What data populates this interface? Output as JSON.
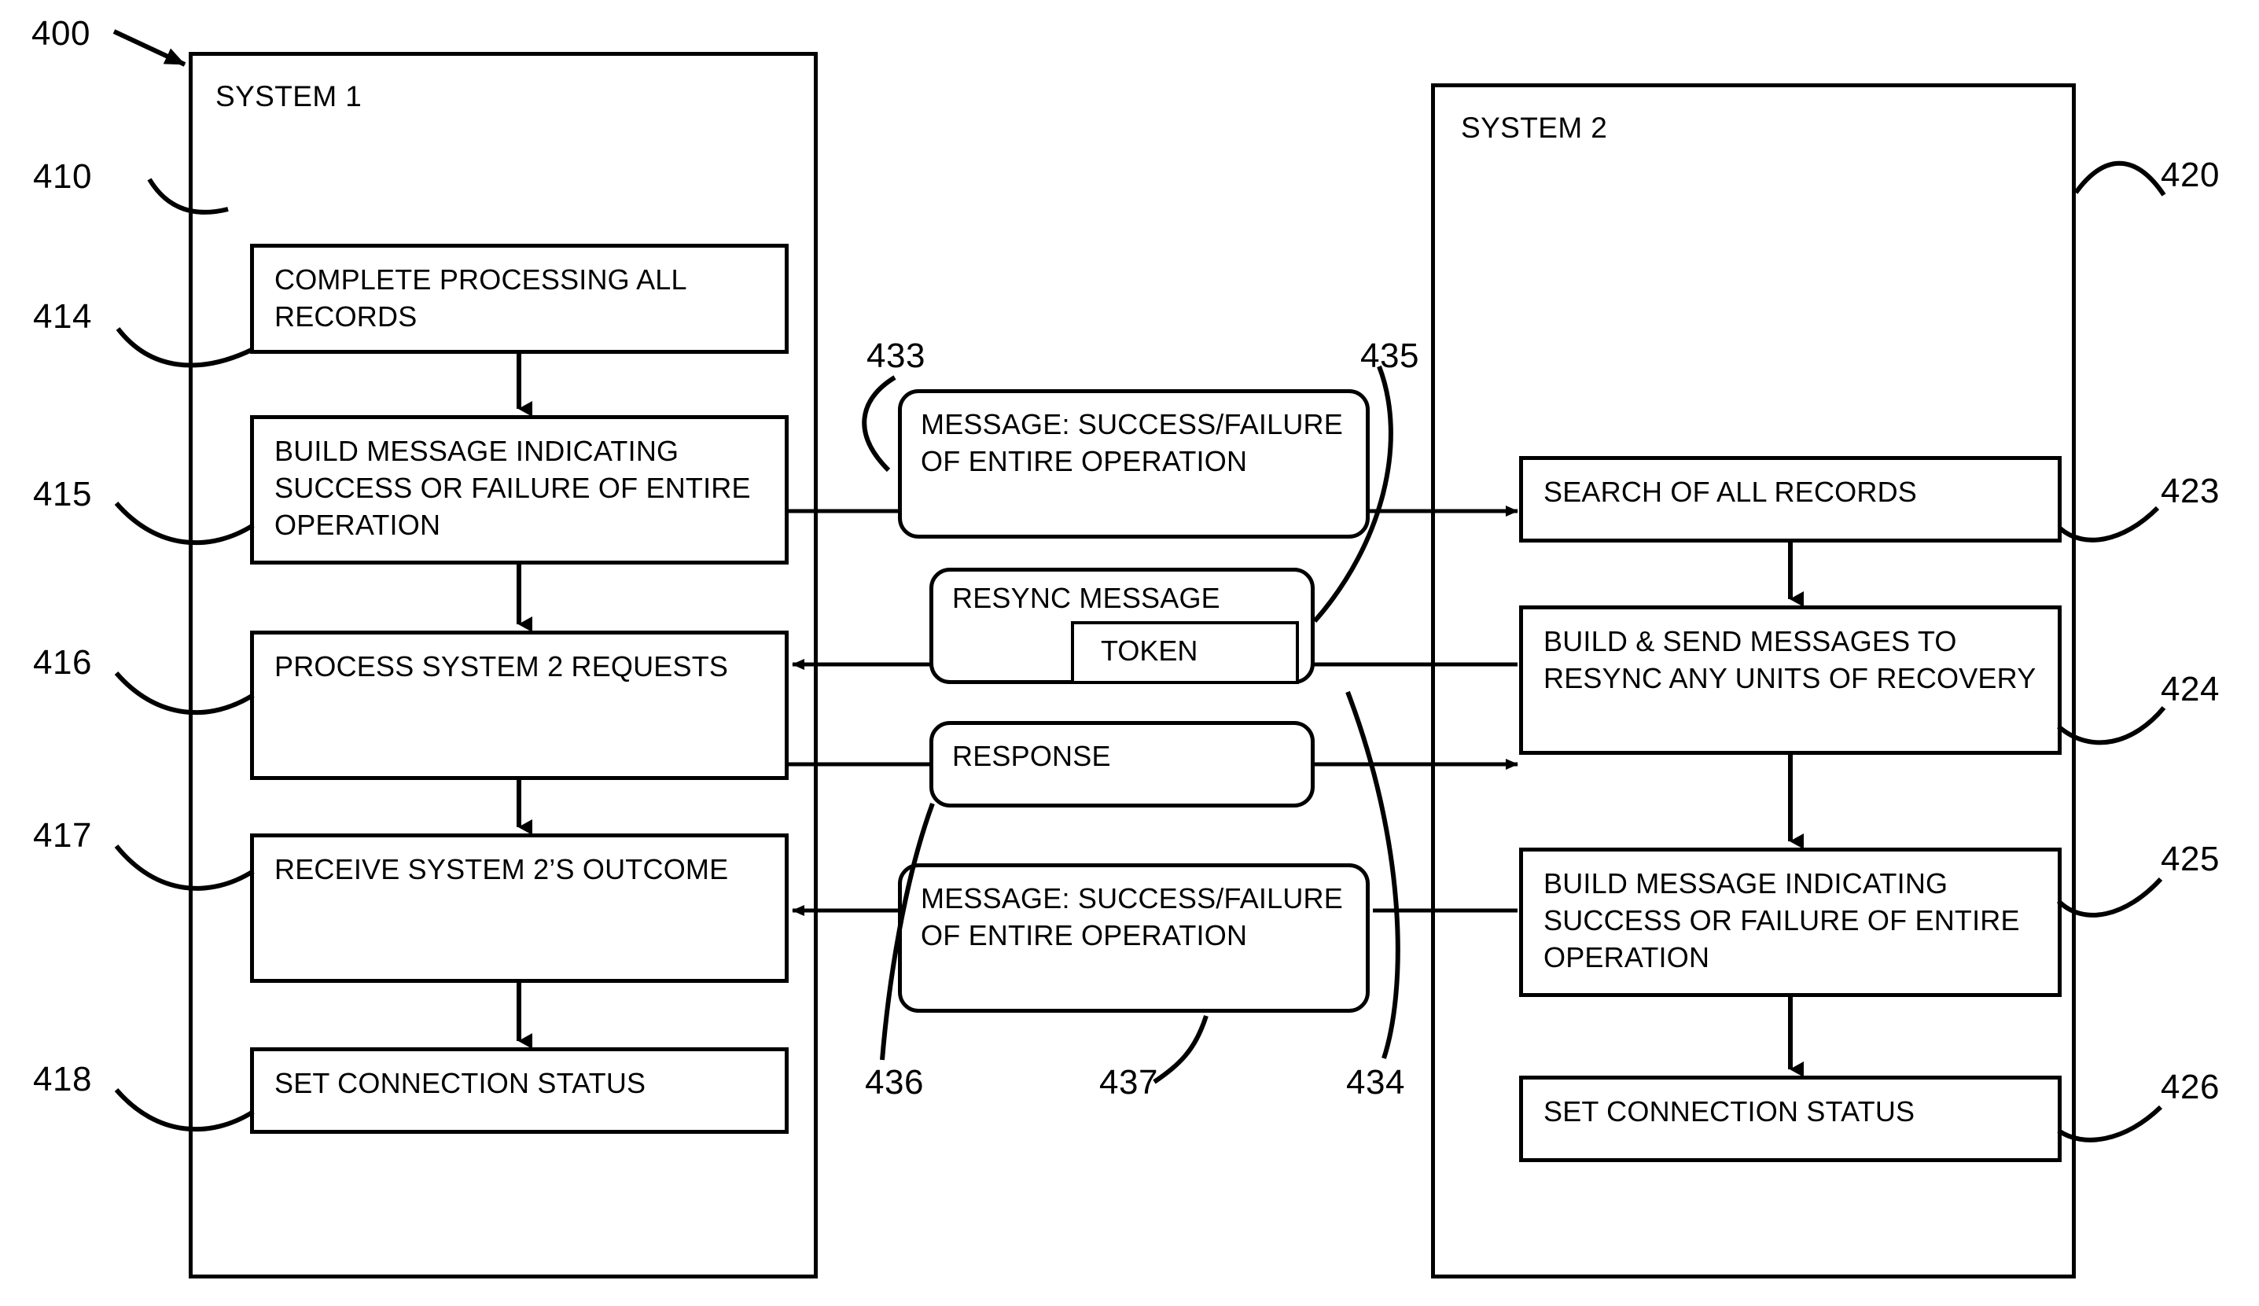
{
  "figure": {
    "figure_number": "400"
  },
  "systems": [
    {
      "id": "system-1",
      "title": "SYSTEM 1",
      "ref": "410"
    },
    {
      "id": "system-2",
      "title": "SYSTEM 2",
      "ref": "420"
    }
  ],
  "system1_steps": [
    {
      "ref": "414",
      "label": "COMPLETE PROCESSING ALL RECORDS"
    },
    {
      "ref": "415",
      "label": "BUILD MESSAGE INDICATING SUCCESS OR FAILURE OF ENTIRE OPERATION"
    },
    {
      "ref": "416",
      "label": "PROCESS SYSTEM 2 REQUESTS"
    },
    {
      "ref": "417",
      "label": "RECEIVE SYSTEM 2’S OUTCOME"
    },
    {
      "ref": "418",
      "label": "SET CONNECTION STATUS"
    }
  ],
  "system2_steps": [
    {
      "ref": "423",
      "label": "SEARCH OF ALL RECORDS"
    },
    {
      "ref": "424",
      "label": "BUILD & SEND MESSAGES TO RESYNC ANY UNITS OF RECOVERY"
    },
    {
      "ref": "425",
      "label": "BUILD MESSAGE INDICATING SUCCESS OR FAILURE OF ENTIRE OPERATION"
    },
    {
      "ref": "426",
      "label": "SET CONNECTION STATUS"
    }
  ],
  "messages": [
    {
      "ref": "433",
      "label": "MESSAGE: SUCCESS/FAILURE OF ENTIRE OPERATION"
    },
    {
      "ref": "435",
      "label": "RESYNC MESSAGE",
      "token_label": "TOKEN"
    },
    {
      "ref": "436",
      "label": "RESPONSE"
    },
    {
      "ref": "437",
      "label": "MESSAGE: SUCCESS/FAILURE OF ENTIRE OPERATION"
    },
    {
      "ref": "434",
      "label": ""
    }
  ],
  "ref_labels": {
    "r400": "400",
    "r410": "410",
    "r414": "414",
    "r415": "415",
    "r416": "416",
    "r417": "417",
    "r418": "418",
    "r420": "420",
    "r423": "423",
    "r424": "424",
    "r425": "425",
    "r426": "426",
    "r433": "433",
    "r434": "434",
    "r435": "435",
    "r436": "436",
    "r437": "437"
  },
  "colors": {
    "line": "#000000",
    "background": "#ffffff"
  }
}
